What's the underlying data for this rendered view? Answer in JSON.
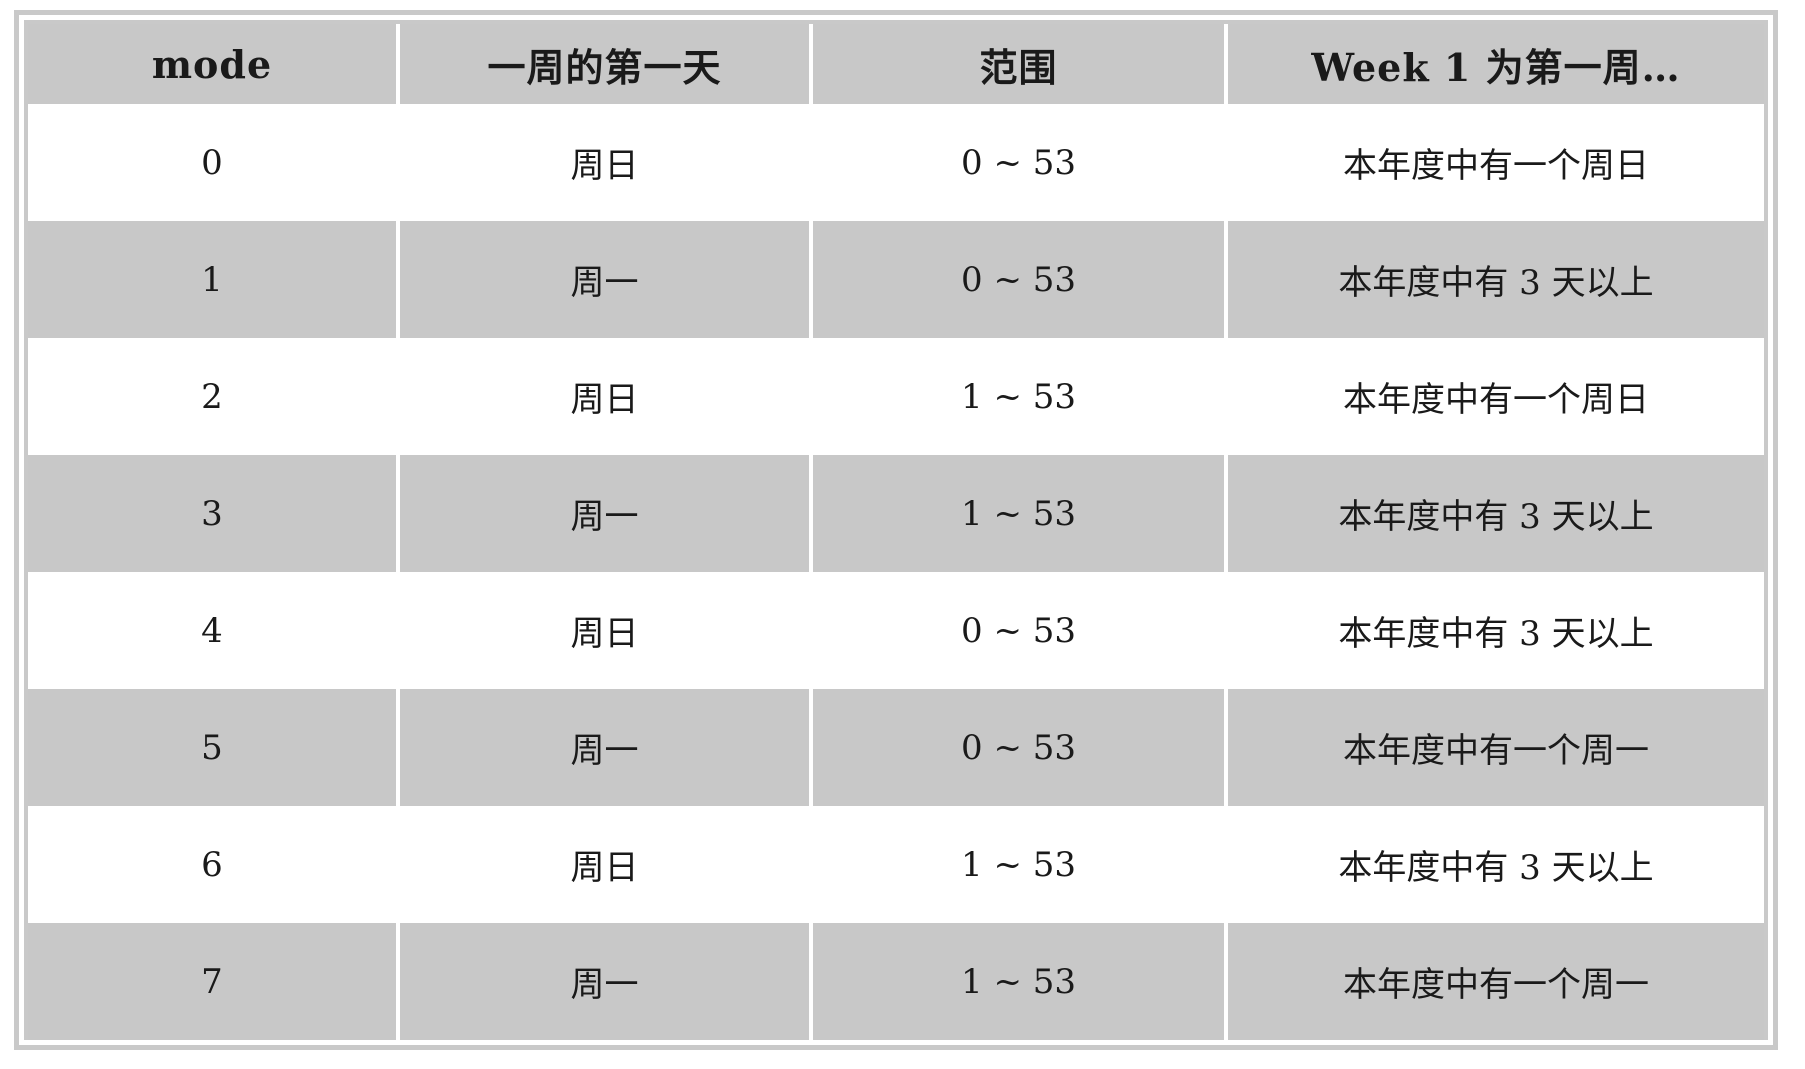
{
  "table": {
    "headers": [
      "mode",
      "一周的第一天",
      "范围",
      "Week 1 为第一周…"
    ],
    "rows": [
      [
        "0",
        "周日",
        "0 ~ 53",
        "本年度中有一个周日"
      ],
      [
        "1",
        "周一",
        "0 ~ 53",
        "本年度中有 3 天以上"
      ],
      [
        "2",
        "周日",
        "1 ~ 53",
        "本年度中有一个周日"
      ],
      [
        "3",
        "周一",
        "1 ~ 53",
        "本年度中有 3 天以上"
      ],
      [
        "4",
        "周日",
        "0 ~ 53",
        "本年度中有 3 天以上"
      ],
      [
        "5",
        "周一",
        "0 ~ 53",
        "本年度中有一个周一"
      ],
      [
        "6",
        "周日",
        "1 ~ 53",
        "本年度中有 3 天以上"
      ],
      [
        "7",
        "周一",
        "1 ~ 53",
        "本年度中有一个周一"
      ]
    ]
  },
  "colors": {
    "header_bg": "#c8c8c8",
    "stripe_bg": "#c8c8c8",
    "row_bg": "#ffffff",
    "border": "#c9c9c9"
  }
}
